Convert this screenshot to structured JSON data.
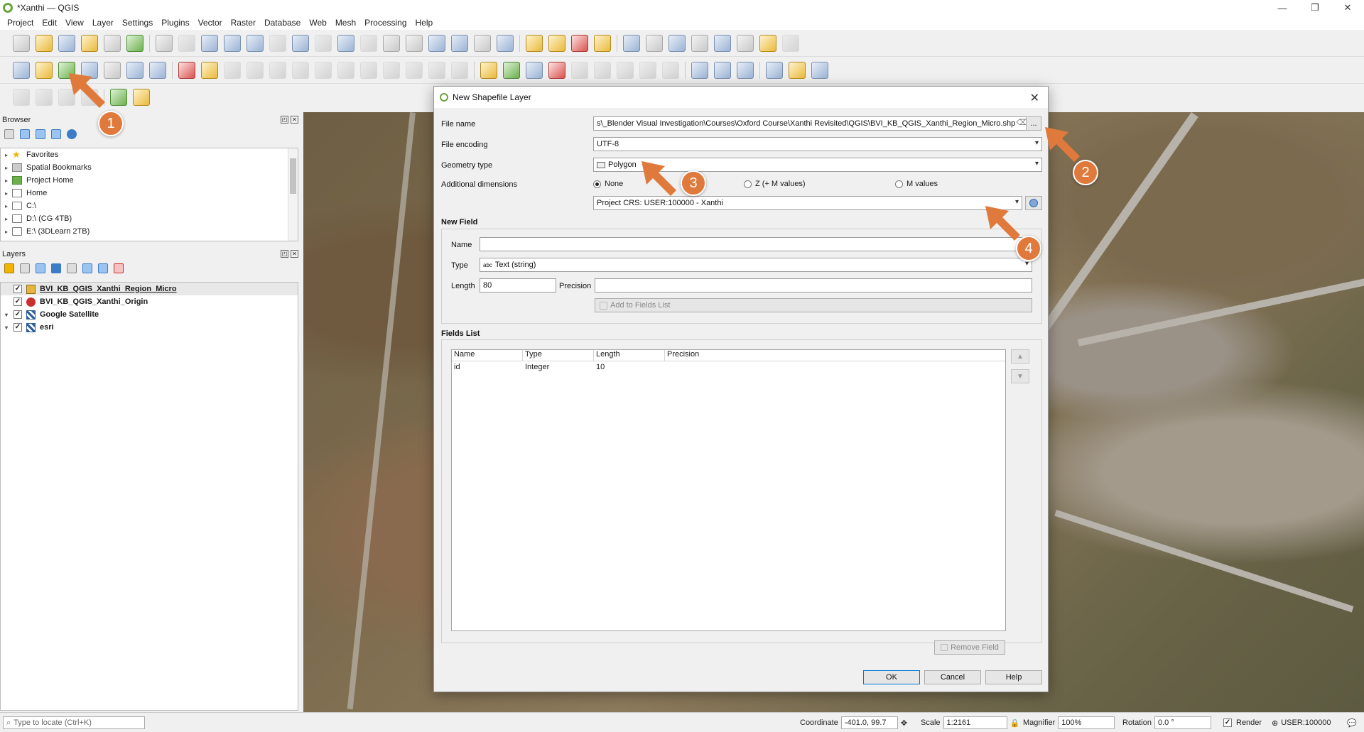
{
  "window": {
    "title": "*Xanthi — QGIS"
  },
  "menu": [
    "Project",
    "Edit",
    "View",
    "Layer",
    "Settings",
    "Plugins",
    "Vector",
    "Raster",
    "Database",
    "Web",
    "Mesh",
    "Processing",
    "Help"
  ],
  "browser": {
    "title": "Browser",
    "items": [
      {
        "label": "Favorites",
        "icon": "star-icon"
      },
      {
        "label": "Spatial Bookmarks",
        "icon": "bookmark-icon"
      },
      {
        "label": "Project Home",
        "icon": "project-home-icon"
      },
      {
        "label": "Home",
        "icon": "home-icon"
      },
      {
        "label": "C:\\",
        "icon": "drive-icon"
      },
      {
        "label": "D:\\ (CG 4TB)",
        "icon": "drive-icon"
      },
      {
        "label": "E:\\ (3DLearn 2TB)",
        "icon": "drive-icon"
      }
    ]
  },
  "layers": {
    "title": "Layers",
    "items": [
      {
        "label": "BVI_KB_QGIS_Xanthi_Region_Micro",
        "checked": true
      },
      {
        "label": "BVI_KB_QGIS_Xanthi_Origin",
        "checked": true
      },
      {
        "label": "Google Satellite",
        "checked": true
      },
      {
        "label": "esri",
        "checked": true
      }
    ]
  },
  "dialog": {
    "title": "New Shapefile Layer",
    "file_name_label": "File name",
    "file_name_value": "s\\_Blender Visual Investigation\\Courses\\Oxford Course\\Xanthi Revisited\\QGIS\\BVI_KB_QGIS_Xanthi_Region_Micro.shp",
    "browse_label": "...",
    "encoding_label": "File encoding",
    "encoding_value": "UTF-8",
    "geometry_label": "Geometry type",
    "geometry_value": "Polygon",
    "dimensions_label": "Additional dimensions",
    "dim_none": "None",
    "dim_z": "Z (+ M values)",
    "dim_m": "M values",
    "crs_value": "Project CRS: USER:100000 - Xanthi",
    "new_field_title": "New Field",
    "name_label": "Name",
    "name_value": "",
    "type_label": "Type",
    "type_value": "Text (string)",
    "type_prefix": "abc",
    "length_label": "Length",
    "length_value": "80",
    "precision_label": "Precision",
    "precision_value": "",
    "add_to_fields_label": "Add to Fields List",
    "fields_list_title": "Fields List",
    "columns": [
      "Name",
      "Type",
      "Length",
      "Precision"
    ],
    "rows": [
      [
        "id",
        "Integer",
        "10",
        ""
      ]
    ],
    "remove_field_label": "Remove Field",
    "ok_label": "OK",
    "cancel_label": "Cancel",
    "help_label": "Help"
  },
  "annotations": [
    "1",
    "2",
    "3",
    "4"
  ],
  "status": {
    "locator_placeholder": "Type to locate (Ctrl+K)",
    "coordinate_label": "Coordinate",
    "coordinate_value": "-401.0, 99.7",
    "scale_label": "Scale",
    "scale_value": "1:2161",
    "magnifier_label": "Magnifier",
    "magnifier_value": "100%",
    "rotation_label": "Rotation",
    "rotation_value": "0.0 °",
    "render_label": "Render",
    "crs_label": "USER:100000"
  },
  "colors": {
    "accent_orange": "#e07a3c",
    "qgis_green": "#6aa43d",
    "ok_border": "#0078d7"
  }
}
